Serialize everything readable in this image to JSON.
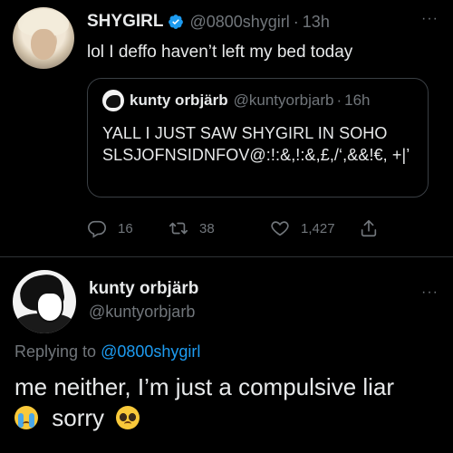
{
  "tweet": {
    "author_name": "SHYGIRL",
    "author_handle": "@0800shygirl",
    "separator": "·",
    "time": "13h",
    "more": "···",
    "text": "lol I deffo haven’t left my bed today",
    "verified_icon": "verified-badge-icon",
    "quote": {
      "author_name": "kunty orbjärb",
      "author_handle": "@kuntyorbjarb",
      "separator": "·",
      "time": "16h",
      "text": "YALL I JUST SAW SHYGIRL IN SOHO SLSJOFNSIDNFOV@:!:&,!:&,£,/‘,&&!€, +|’"
    },
    "actions": {
      "reply_count": "16",
      "retweet_count": "38",
      "like_count": "1,427"
    }
  },
  "reply": {
    "author_name": "kunty orbjärb",
    "author_handle": "@kuntyorbjarb",
    "more": "···",
    "replying_label": "Replying to",
    "replying_to": "@0800shygirl",
    "text_line1": "me neither, I’m just a compulsive liar",
    "text_line2_word": "sorry",
    "emoji_1": "loudly-crying-face-icon",
    "emoji_2": "pleading-face-icon"
  },
  "colors": {
    "background": "#000000",
    "text": "#e7e9ea",
    "muted": "#71767b",
    "link": "#1d9bf0",
    "verified": "#1d9bf0",
    "border": "#2f3336"
  }
}
